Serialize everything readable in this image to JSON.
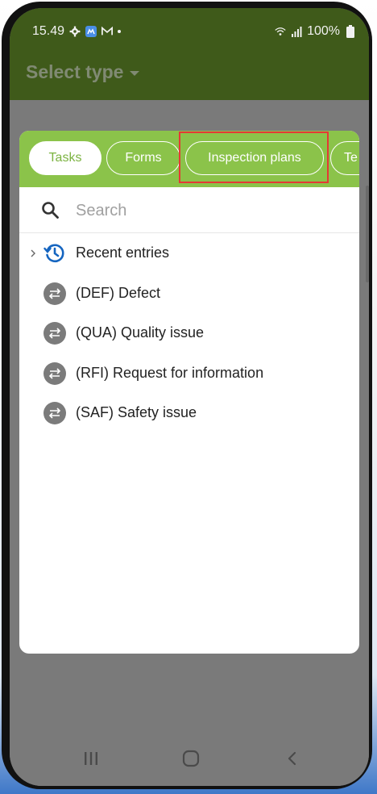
{
  "status": {
    "time": "15.49",
    "battery": "100%",
    "icons": [
      "gear-icon",
      "app-icon",
      "mail-icon",
      "dot-icon",
      "wifi-icon",
      "signal-icon",
      "battery-icon"
    ]
  },
  "appbar": {
    "title": "Select type",
    "dropdown_icon": "chevron-down-icon"
  },
  "dialog": {
    "tabs": [
      {
        "label": "Tasks",
        "active": true
      },
      {
        "label": "Forms",
        "active": false
      },
      {
        "label": "Inspection plans",
        "active": false
      },
      {
        "label": "Te",
        "active": false
      }
    ],
    "search": {
      "placeholder": "Search",
      "icon": "search-icon"
    },
    "items": [
      {
        "label": "Recent entries",
        "icon": "history-icon",
        "expandable": true
      },
      {
        "label": "(DEF) Defect",
        "icon": "transfer-icon",
        "expandable": false
      },
      {
        "label": "(QUA) Quality issue",
        "icon": "transfer-icon",
        "expandable": false
      },
      {
        "label": "(RFI) Request for information",
        "icon": "transfer-icon",
        "expandable": false
      },
      {
        "label": "(SAF) Safety issue",
        "icon": "transfer-icon",
        "expandable": false
      }
    ]
  },
  "colors": {
    "appbar": "#3f5a1a",
    "tabs_bg": "#8bc34a",
    "tab_active_text": "#7cb342",
    "highlight": "#e53935",
    "overlay": "#7a7a7a",
    "history_icon": "#1565c0",
    "item_icon_bg": "#7b7b7b"
  },
  "navbar": {
    "icons": [
      "recents-icon",
      "home-icon",
      "back-icon"
    ]
  }
}
